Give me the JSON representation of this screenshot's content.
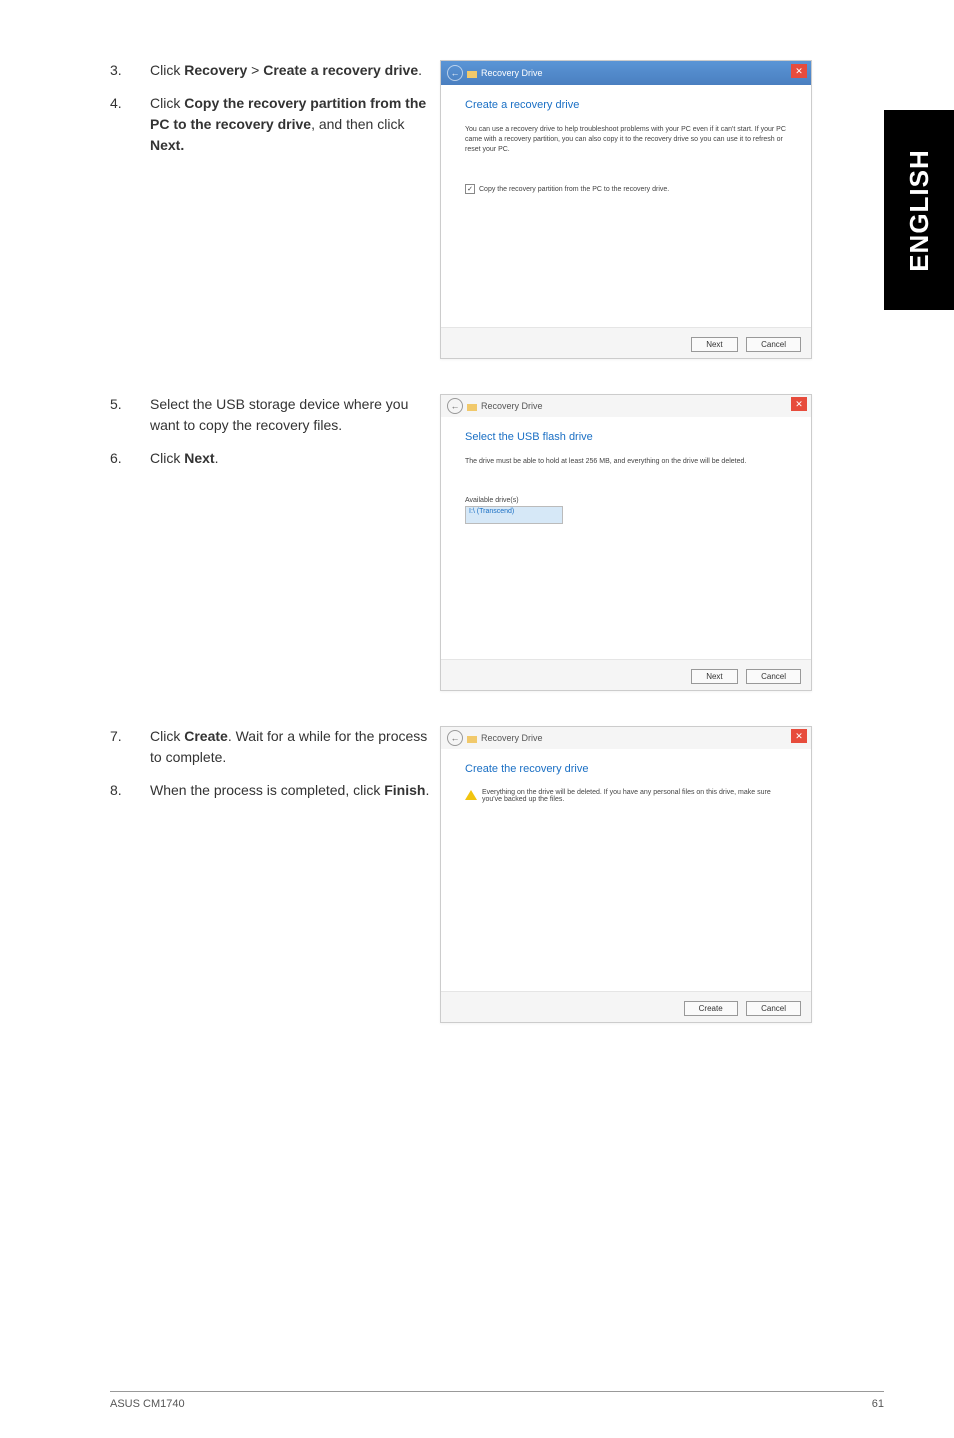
{
  "sideTab": "ENGLISH",
  "steps": {
    "s3": {
      "num": "3.",
      "pre": "Click ",
      "b1": "Recovery",
      "mid": " > ",
      "b2": "Create a recovery drive",
      "post": "."
    },
    "s4": {
      "num": "4.",
      "pre": "Click ",
      "b1": "Copy the recovery partition from the PC to the recovery drive",
      "mid": ", and then click ",
      "b2": "Next.",
      "post": ""
    },
    "s5": {
      "num": "5.",
      "text": "Select the USB storage device where you want to copy the recovery files."
    },
    "s6": {
      "num": "6.",
      "pre": "Click ",
      "b1": "Next",
      "post": "."
    },
    "s7": {
      "num": "7.",
      "pre": "Click ",
      "b1": "Create",
      "post": ". Wait for a while for the process to complete."
    },
    "s8": {
      "num": "8.",
      "pre": "When the process is completed, click ",
      "b1": "Finish",
      "post": "."
    }
  },
  "shot1": {
    "title": "Recovery Drive",
    "heading": "Create a recovery drive",
    "desc": "You can use a recovery drive to help troubleshoot problems with your PC even if it can't start. If your PC came with a recovery partition, you can also copy it to the recovery drive so you can use it to refresh or reset your PC.",
    "checkbox": "Copy the recovery partition from the PC to the recovery drive.",
    "btnNext": "Next",
    "btnCancel": "Cancel"
  },
  "shot2": {
    "title": "Recovery Drive",
    "heading": "Select the USB flash drive",
    "desc": "The drive must be able to hold at least 256 MB, and everything on the drive will be deleted.",
    "listLabel": "Available drive(s)",
    "listItem": "I:\\ (Transcend)",
    "btnNext": "Next",
    "btnCancel": "Cancel"
  },
  "shot3": {
    "title": "Recovery Drive",
    "heading": "Create the recovery drive",
    "warn": "Everything on the drive will be deleted. If you have any personal files on this drive, make sure you've backed up the files.",
    "btnCreate": "Create",
    "btnCancel": "Cancel"
  },
  "footer": {
    "left": "ASUS CM1740",
    "right": "61"
  }
}
